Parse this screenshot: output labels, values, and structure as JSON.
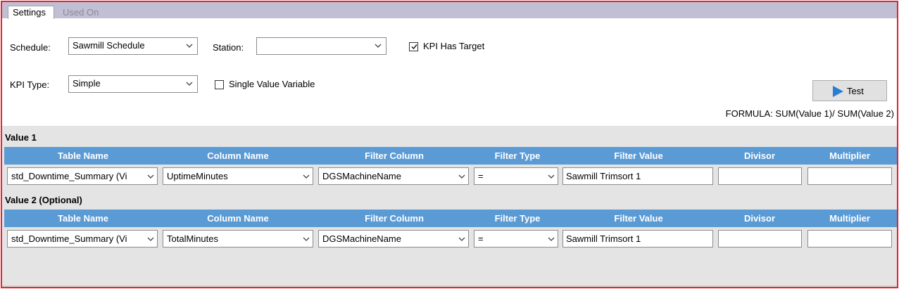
{
  "tabs": [
    {
      "label": "Settings",
      "active": true
    },
    {
      "label": "Used On",
      "active": false
    }
  ],
  "settings": {
    "schedule_label": "Schedule:",
    "schedule_value": "Sawmill Schedule",
    "station_label": "Station:",
    "station_value": "",
    "kpi_has_target_label": "KPI Has Target",
    "kpi_has_target_checked": true,
    "kpi_type_label": "KPI Type:",
    "kpi_type_value": "Simple",
    "single_value_label": "Single Value Variable",
    "single_value_checked": false,
    "test_button_label": "Test",
    "formula_text": "FORMULA:  SUM(Value 1)/ SUM(Value 2)"
  },
  "columns": [
    "Table Name",
    "Column Name",
    "Filter Column",
    "Filter Type",
    "Filter Value",
    "Divisor",
    "Multiplier"
  ],
  "value1": {
    "title": "Value 1",
    "row": {
      "table_name": "std_Downtime_Summary (Vi",
      "column_name": "UptimeMinutes",
      "filter_column": "DGSMachineName",
      "filter_type": "=",
      "filter_value": "Sawmill Trimsort 1",
      "divisor": "",
      "multiplier": ""
    }
  },
  "value2": {
    "title": "Value 2 (Optional)",
    "row": {
      "table_name": "std_Downtime_Summary (Vi",
      "column_name": "TotalMinutes",
      "filter_column": "DGSMachineName",
      "filter_type": "=",
      "filter_value": "Sawmill Trimsort 1",
      "divisor": "",
      "multiplier": ""
    }
  },
  "colors": {
    "header_blue": "#5b9bd5",
    "frame_red": "#e2262f",
    "tab_strip": "#c0bfd3",
    "play_blue": "#2b7cd3"
  },
  "icons": {
    "dropdown": "chevron-down-icon",
    "test": "play-icon",
    "checked": "checkmark-icon"
  }
}
